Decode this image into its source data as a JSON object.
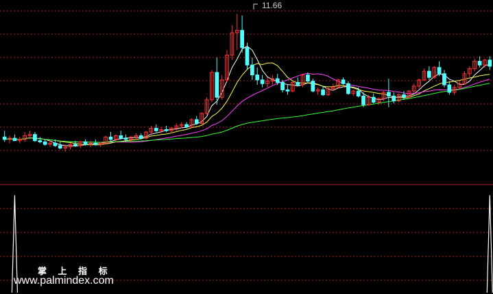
{
  "chart_data": [
    {
      "type": "candlestick",
      "annotations": [
        {
          "text": "11.66",
          "at": "highest high"
        }
      ],
      "ylim": [
        5.0,
        12.0
      ],
      "colors": {
        "up": "#ff3333",
        "down": "#54ffff",
        "ma_short": "#ffffff",
        "ma_mid": "#ffff55",
        "ma_long": "#ff44ff",
        "ma_longest": "#33ff33",
        "grid": "#b01e1e"
      },
      "candles": [
        [
          6.7,
          6.95,
          6.5,
          6.6
        ],
        [
          6.6,
          6.75,
          6.45,
          6.65
        ],
        [
          6.65,
          6.8,
          6.55,
          6.55
        ],
        [
          6.55,
          6.7,
          6.45,
          6.6
        ],
        [
          6.6,
          6.9,
          6.5,
          6.75
        ],
        [
          6.75,
          6.95,
          6.6,
          6.8
        ],
        [
          6.8,
          6.9,
          6.5,
          6.55
        ],
        [
          6.55,
          6.7,
          6.45,
          6.5
        ],
        [
          6.5,
          6.6,
          6.35,
          6.4
        ],
        [
          6.4,
          6.55,
          6.3,
          6.45
        ],
        [
          6.45,
          6.6,
          6.3,
          6.35
        ],
        [
          6.35,
          6.5,
          6.2,
          6.25
        ],
        [
          6.25,
          6.4,
          6.1,
          6.3
        ],
        [
          6.3,
          6.45,
          6.2,
          6.4
        ],
        [
          6.4,
          6.55,
          6.3,
          6.35
        ],
        [
          6.35,
          6.55,
          6.25,
          6.5
        ],
        [
          6.5,
          6.6,
          6.35,
          6.4
        ],
        [
          6.4,
          6.55,
          6.3,
          6.45
        ],
        [
          6.45,
          6.6,
          6.35,
          6.4
        ],
        [
          6.4,
          6.5,
          6.3,
          6.45
        ],
        [
          6.45,
          6.75,
          6.4,
          6.7
        ],
        [
          6.7,
          6.9,
          6.55,
          6.6
        ],
        [
          6.6,
          6.8,
          6.5,
          6.75
        ],
        [
          6.75,
          6.95,
          6.6,
          6.65
        ],
        [
          6.65,
          6.8,
          6.5,
          6.6
        ],
        [
          6.6,
          6.75,
          6.5,
          6.7
        ],
        [
          6.7,
          6.85,
          6.6,
          6.75
        ],
        [
          6.75,
          6.85,
          6.6,
          6.65
        ],
        [
          6.65,
          6.95,
          6.6,
          6.9
        ],
        [
          6.9,
          7.15,
          6.8,
          7.05
        ],
        [
          7.05,
          7.2,
          6.9,
          6.95
        ],
        [
          6.95,
          7.1,
          6.85,
          7.0
        ],
        [
          7.0,
          7.15,
          6.9,
          6.95
        ],
        [
          6.95,
          7.1,
          6.85,
          7.05
        ],
        [
          7.05,
          7.25,
          6.95,
          7.15
        ],
        [
          7.15,
          7.3,
          7.05,
          7.2
        ],
        [
          7.2,
          7.3,
          7.05,
          7.1
        ],
        [
          7.1,
          7.45,
          7.05,
          7.4
        ],
        [
          7.4,
          7.55,
          7.2,
          7.25
        ],
        [
          7.25,
          7.7,
          7.2,
          7.65
        ],
        [
          7.65,
          8.3,
          7.6,
          8.2
        ],
        [
          8.2,
          9.4,
          8.1,
          9.3
        ],
        [
          9.3,
          9.9,
          8.0,
          8.3
        ],
        [
          8.3,
          9.2,
          8.2,
          9.0
        ],
        [
          9.0,
          10.2,
          8.9,
          10.0
        ],
        [
          10.0,
          11.2,
          9.8,
          10.9
        ],
        [
          10.9,
          11.66,
          10.2,
          11.0
        ],
        [
          11.0,
          11.6,
          10.1,
          10.3
        ],
        [
          10.3,
          10.5,
          9.4,
          9.6
        ],
        [
          9.6,
          9.9,
          9.0,
          9.2
        ],
        [
          9.2,
          9.5,
          8.8,
          9.0
        ],
        [
          9.0,
          9.2,
          8.7,
          8.85
        ],
        [
          8.85,
          9.1,
          8.7,
          8.95
        ],
        [
          8.95,
          9.2,
          8.8,
          9.05
        ],
        [
          9.05,
          9.25,
          8.8,
          8.9
        ],
        [
          8.9,
          9.0,
          8.5,
          8.6
        ],
        [
          8.6,
          8.8,
          8.4,
          8.55
        ],
        [
          8.55,
          8.95,
          8.5,
          8.9
        ],
        [
          8.9,
          9.1,
          8.75,
          8.8
        ],
        [
          8.8,
          9.25,
          8.7,
          9.2
        ],
        [
          9.2,
          9.3,
          8.9,
          8.95
        ],
        [
          8.95,
          9.05,
          8.5,
          8.55
        ],
        [
          8.55,
          8.7,
          8.4,
          8.6
        ],
        [
          8.6,
          8.75,
          8.35,
          8.4
        ],
        [
          8.4,
          8.7,
          8.35,
          8.65
        ],
        [
          8.65,
          8.85,
          8.55,
          8.7
        ],
        [
          8.7,
          9.05,
          8.65,
          9.0
        ],
        [
          9.0,
          9.1,
          8.8,
          8.85
        ],
        [
          8.85,
          8.95,
          8.4,
          8.45
        ],
        [
          8.45,
          8.6,
          8.35,
          8.55
        ],
        [
          8.55,
          8.7,
          8.3,
          8.35
        ],
        [
          8.35,
          8.5,
          7.9,
          8.0
        ],
        [
          8.0,
          8.4,
          7.95,
          8.3
        ],
        [
          8.3,
          8.45,
          8.05,
          8.1
        ],
        [
          8.1,
          8.3,
          8.0,
          8.25
        ],
        [
          8.25,
          8.55,
          8.15,
          8.5
        ],
        [
          8.5,
          9.05,
          7.9,
          8.35
        ],
        [
          8.35,
          8.5,
          8.05,
          8.15
        ],
        [
          8.15,
          8.45,
          8.1,
          8.4
        ],
        [
          8.4,
          8.55,
          8.2,
          8.3
        ],
        [
          8.3,
          8.6,
          8.25,
          8.55
        ],
        [
          8.55,
          8.85,
          8.45,
          8.75
        ],
        [
          8.75,
          9.05,
          8.65,
          9.0
        ],
        [
          9.0,
          9.45,
          8.95,
          9.35
        ],
        [
          9.35,
          9.55,
          9.0,
          9.1
        ],
        [
          9.1,
          9.55,
          9.05,
          9.5
        ],
        [
          9.5,
          9.75,
          9.15,
          9.25
        ],
        [
          9.25,
          9.4,
          8.7,
          8.8
        ],
        [
          8.8,
          8.95,
          8.4,
          8.5
        ],
        [
          8.5,
          8.8,
          8.4,
          8.7
        ],
        [
          8.7,
          8.95,
          8.6,
          8.85
        ],
        [
          8.85,
          9.35,
          8.8,
          9.25
        ],
        [
          9.25,
          9.55,
          9.1,
          9.45
        ],
        [
          9.45,
          9.85,
          9.35,
          9.75
        ],
        [
          9.75,
          9.95,
          9.5,
          9.6
        ],
        [
          9.6,
          9.85,
          9.5,
          9.8
        ],
        [
          9.8,
          9.95,
          9.4,
          9.55
        ]
      ]
    },
    {
      "type": "line",
      "ylim": [
        0,
        1
      ],
      "colors": {
        "signal": "#ffffff"
      },
      "signals": [
        {
          "index": 2,
          "value": 0.95
        },
        {
          "index": 96,
          "value": 0.95
        }
      ]
    }
  ],
  "watermark": {
    "title": "掌 上 指 标",
    "url": "www.palmindex.com"
  }
}
